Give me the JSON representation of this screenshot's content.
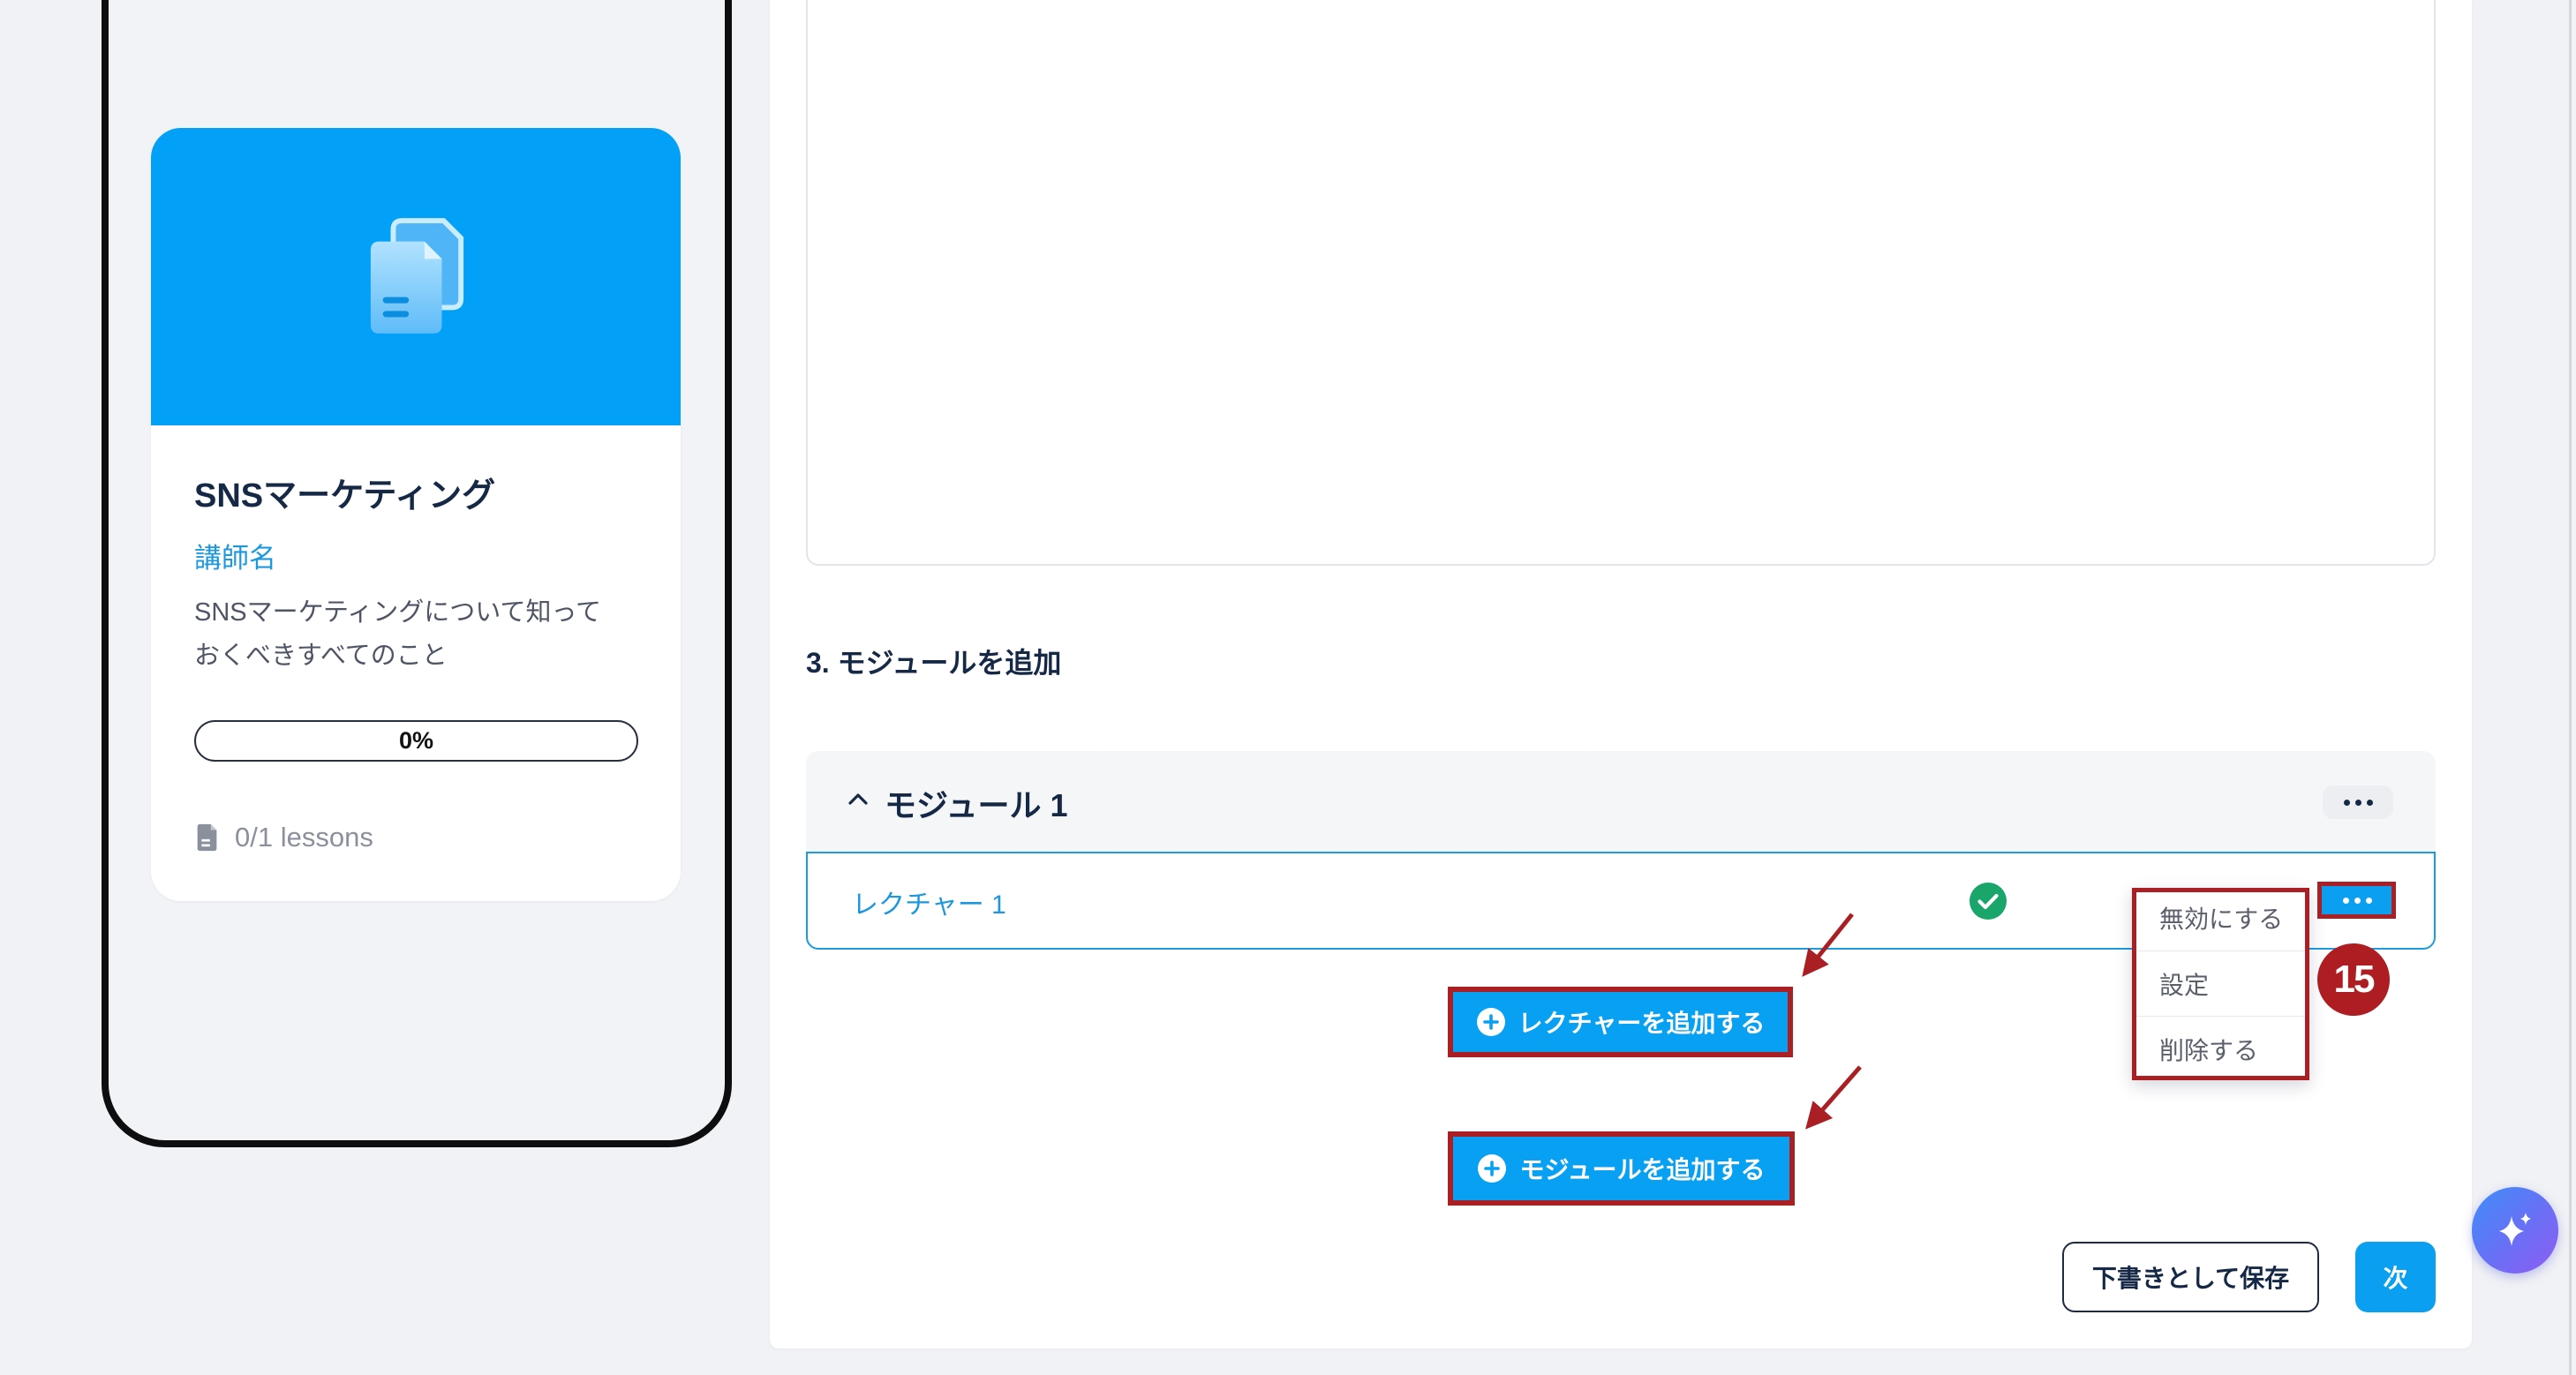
{
  "course_card": {
    "title": "SNSマーケティング",
    "instructor": "講師名",
    "description_lines": [
      "SNSマーケティングについて知って",
      "おくべきすべてのこと"
    ],
    "progress_percent": 0,
    "progress_label": "0%",
    "lessons": "0/1 lessons",
    "hero_icon": "document-stack-icon",
    "lessons_icon": "document-icon"
  },
  "builder": {
    "section_heading": "3. モジュールを追加",
    "module": {
      "title": "モジュール 1",
      "expanded": true,
      "menu_icon": "more-horizontal-icon",
      "lectures": [
        {
          "title": "レクチャー 1",
          "status_icon": "check-circle-icon"
        }
      ]
    },
    "context_menu": {
      "items": [
        "無効にする",
        "設定",
        "削除する"
      ]
    },
    "add_lecture_label": "レクチャーを追加する",
    "add_module_label": "モジュールを追加する"
  },
  "footer": {
    "save_draft_label": "下書きとして保存",
    "next_label": "次"
  },
  "annotation": {
    "step_number": "15"
  },
  "colors": {
    "accent": "#0a9ff0",
    "hero": "#02a0f6",
    "text_navy": "#152846",
    "link": "#1d98df",
    "success": "#1aa56b",
    "annotation_red": "#a91f24",
    "page_background": "#f1f2f5"
  }
}
